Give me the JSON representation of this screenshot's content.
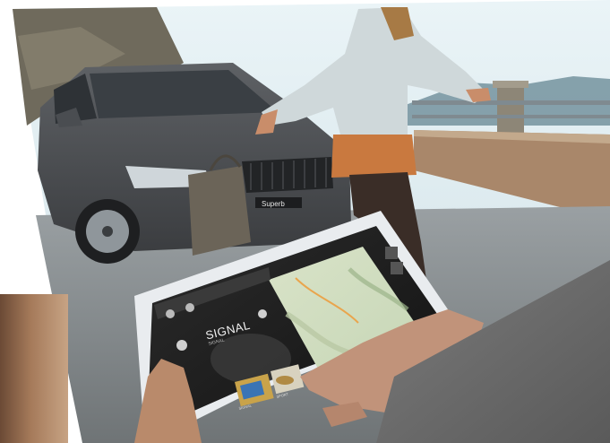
{
  "image": {
    "kind": "photo",
    "visible_text": {
      "tablet_title": "SIGNAL",
      "tablet_subtitle": "SIGNAL",
      "car_plate": "Superb",
      "tab_label_1": "SIGNAL",
      "tab_label_2": "SPORT"
    }
  }
}
